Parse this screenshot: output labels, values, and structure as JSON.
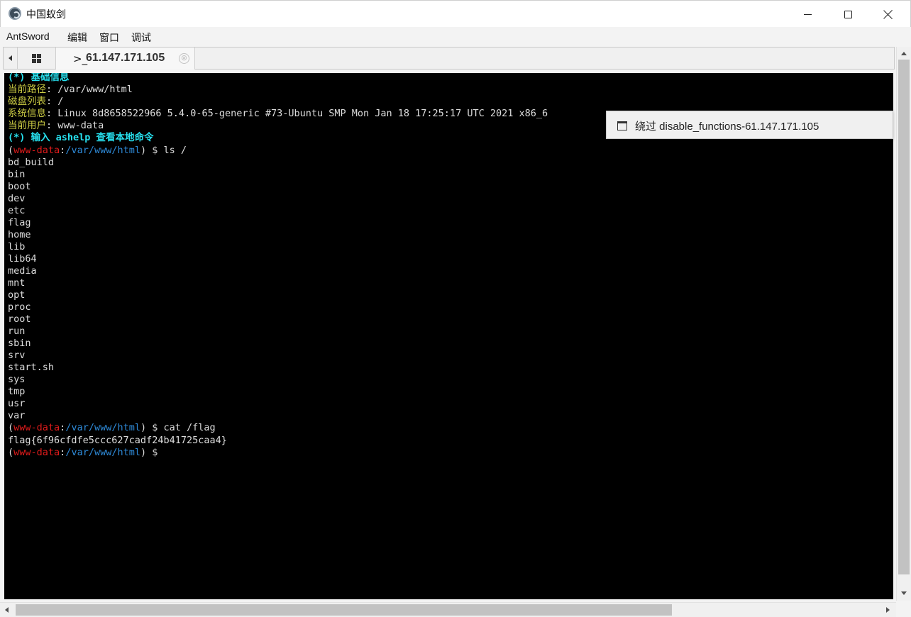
{
  "window": {
    "title": "中国蚁剑",
    "icon": "antsword-logo-icon"
  },
  "menu": {
    "items": [
      "AntSword",
      "编辑",
      "窗口",
      "调试"
    ]
  },
  "tabs": {
    "home_icon": "grid-icon",
    "terminal_prefix": ">_",
    "terminal_label": "61.147.171.105",
    "close_glyph": "⊗"
  },
  "terminal": {
    "info_header": "(*) 基础信息",
    "path_label": "当前路径",
    "path_value": ": /var/www/html",
    "disk_label": "磁盘列表",
    "disk_value": ": /",
    "sys_label": "系统信息",
    "sys_value": ": Linux 8d8658522966 5.4.0-65-generic #73-Ubuntu SMP Mon Jan 18 17:25:17 UTC 2021 x86_6",
    "user_label": "当前用户",
    "user_value": ": www-data",
    "help_line": "(*) 输入 ashelp 查看本地命令",
    "prompt": {
      "open": "(",
      "user": "www-data",
      "colon": ":",
      "path": "/var/www/html",
      "close": ") $"
    },
    "cmd1": " ls /",
    "ls_output": [
      "bd_build",
      "bin",
      "boot",
      "dev",
      "etc",
      "flag",
      "home",
      "lib",
      "lib64",
      "media",
      "mnt",
      "opt",
      "proc",
      "root",
      "run",
      "sbin",
      "srv",
      "start.sh",
      "sys",
      "tmp",
      "usr",
      "var"
    ],
    "cmd2": " cat /flag",
    "flag_output": "flag{6f96cfdfe5ccc627cadf24b41725caa4}"
  },
  "popup": {
    "icon": "window-icon",
    "label": "绕过 disable_functions-61.147.171.105"
  },
  "colors": {
    "terminal_bg": "#000000",
    "cyan": "#27e0ee",
    "yellow": "#cccc44",
    "red": "#e01b1b",
    "blue": "#2e8ad8"
  }
}
